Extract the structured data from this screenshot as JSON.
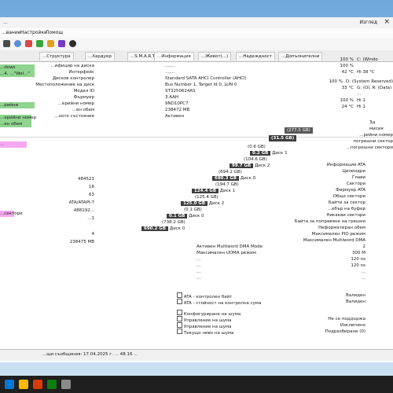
{
  "window": {
    "title": "...",
    "right_title": "Изглед"
  },
  "menu": [
    "...вание",
    "Настройки",
    "Помощ"
  ],
  "tabs": [
    "...Структура",
    "...Хардуер",
    "...S.M.A.R.T.",
    "...Информация",
    "...Живот(...)",
    "...Надеждност",
    "...Допълнителни"
  ],
  "tree_left": [
    "...dows",
    "...4, ...\"Wel...\"",
    "...рийни",
    "...ерийни номер",
    "...ен обем",
    "...",
    "...сектори"
  ],
  "info_rows": [
    {
      "label": "...ифицир на диска",
      "value": "...,..."
    },
    {
      "label": "Интерфейс",
      "value": "...,..."
    },
    {
      "label": "Дисков контролер",
      "value": "Standard SATA AHCI Controller (AHCI)"
    },
    {
      "label": "Местоположение на диск",
      "value": "Bus Number 1, Target Id 0, LUN 0"
    },
    {
      "label": "Модел ID",
      "value": "ST3250624AS"
    },
    {
      "label": "Фърмуер",
      "value": "3.AAH"
    },
    {
      "label": "...ерийни номер",
      "value": "9ND10PC7"
    },
    {
      "label": "...ен обем",
      "value": "238472 MB"
    },
    {
      "label": "...ното състояние",
      "value": "Активен"
    }
  ],
  "left_values": [
    "484521",
    "16",
    "63",
    "ATA/ATAPI-7",
    "488192...",
    "...1",
    "",
    "4",
    "238475 MB"
  ],
  "partitions": [
    {
      "label": "(0.6 GB)",
      "pill": false
    },
    {
      "label": "0.2 GB",
      "pill": true,
      "note": "Диск 1"
    },
    {
      "label": "(104.6 GB)",
      "pill": false
    },
    {
      "label": "99.7 GB",
      "pill": true,
      "note": "Диск 2"
    },
    {
      "label": "(694.2 GB)",
      "pill": false
    },
    {
      "label": "680.3 GB",
      "pill": true,
      "note": "Диск 0"
    },
    {
      "label": "(194.7 GB)",
      "pill": false
    },
    {
      "label": "124.4 GB",
      "pill": true,
      "note": "Диск 1"
    },
    {
      "label": "(125.4 GB)",
      "pill": false
    },
    {
      "label": "125.0 GB",
      "pill": true,
      "note": "Диск 2"
    },
    {
      "label": "(0.1 GB)",
      "pill": false
    },
    {
      "label": "0.1 GB",
      "pill": true,
      "note": "Диск 0"
    },
    {
      "label": "(738.2 GB)",
      "pill": false
    },
    {
      "label": "690.2 GB",
      "pill": true,
      "note": "Диск 0"
    }
  ],
  "features": [
    {
      "label": "Информация ATA",
      "value": ""
    },
    {
      "label": "Цилиндри",
      "value": ""
    },
    {
      "label": "Глави",
      "value": ""
    },
    {
      "label": "Сектори",
      "value": ""
    },
    {
      "label": "Фирмуер ATA",
      "value": ""
    },
    {
      "label": "Общо сектори",
      "value": ""
    },
    {
      "label": "Байти за сектор",
      "value": ""
    },
    {
      "label": "...ебър на буфер",
      "value": ""
    },
    {
      "label": "Никакви сектори",
      "value": ""
    },
    {
      "label": "Байта за поправяне на грешки",
      "value": ""
    },
    {
      "label": "Неформатиран обем",
      "value": ""
    },
    {
      "label": "Максимален PIO режим",
      "value": ""
    },
    {
      "label": "Максимален Multiword DMA",
      "value": ""
    },
    {
      "label": "Активен Multiword DMA Mode",
      "value": "2"
    },
    {
      "label": "Максимален UDMA режим",
      "value": "300 M"
    },
    {
      "label": "...",
      "value": "120 ns"
    },
    {
      "label": "...",
      "value": "120 ns"
    },
    {
      "label": "...",
      "value": "..."
    },
    {
      "label": "...",
      "value": "..."
    }
  ],
  "checks": [
    {
      "label": "ATA - контролен байт",
      "value": "Валиден"
    },
    {
      "label": "ATA - стойност на контролна сума",
      "value": "Валиден"
    },
    {
      "label": "Конфигуриране на шума",
      "value": ""
    },
    {
      "label": "Управление на шума",
      "value": "Не се поддържа"
    },
    {
      "label": "Управление на шума",
      "value": "Изключено"
    },
    {
      "label": "Текущо ниво на шума",
      "value": "Подразбиране (0)"
    }
  ],
  "right_list": [
    {
      "pct": "100 %",
      "text": "C: (Windo"
    },
    {
      "pct": "100 %",
      "text": ""
    },
    {
      "pct": "42 °C",
      "text": "Hi 38 °C"
    },
    {
      "pct": "100 %",
      "text": "D: (System Reserved)"
    },
    {
      "pct": "33 °C",
      "text": "G: (OI, R: (Data)"
    },
    {
      "pct": "",
      "text": "..."
    },
    {
      "pct": "100 %",
      "text": "Hi 1"
    },
    {
      "pct": "24 °C",
      "text": "Hi 1"
    }
  ],
  "right_side": [
    "Зд",
    "мисия",
    "...рийни номер",
    "погрешни сектор",
    "...погрешни сектори"
  ],
  "usage_pills": [
    {
      "label": "(277.5 GB)"
    },
    {
      "label": "(31.5 GB)"
    }
  ],
  "status_text": "...щи съобщения: 17.04.2025 г. ... 48:16 ..."
}
